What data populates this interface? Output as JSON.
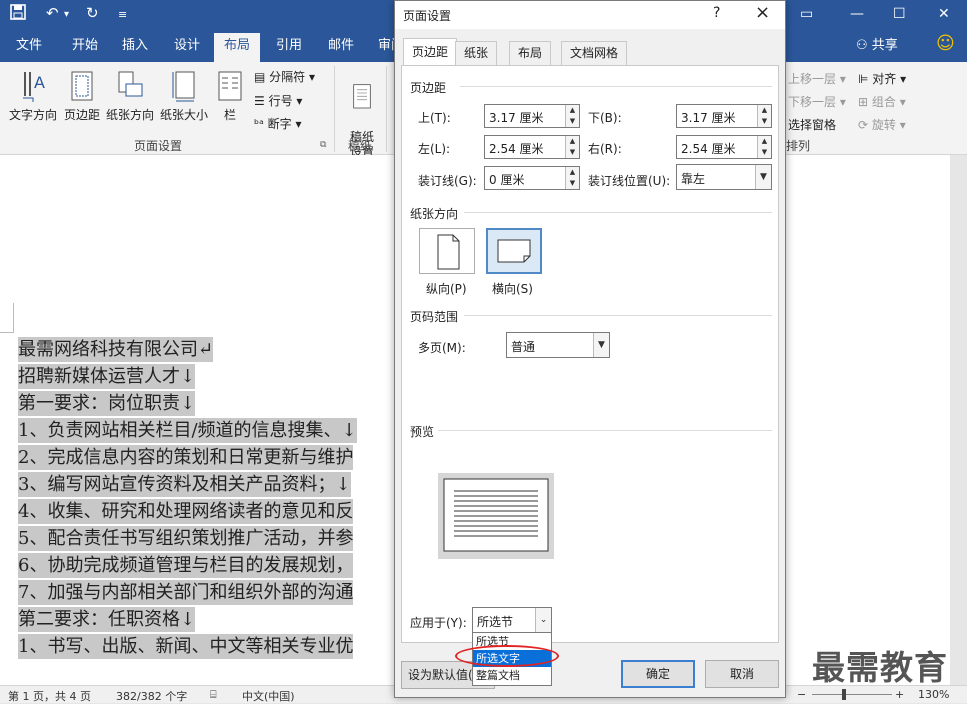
{
  "app": {
    "tabs": [
      "文件",
      "开始",
      "插入",
      "设计",
      "布局",
      "引用",
      "邮件",
      "审阅"
    ],
    "active_tab": "布局",
    "share_label": "共享",
    "quick_access": [
      "save-icon",
      "undo-icon",
      "redo-icon",
      "customize-icon"
    ]
  },
  "ribbon": {
    "page_setup": {
      "text_direction": "文字方向",
      "margins": "页边距",
      "orientation": "纸张方向",
      "size": "纸张大小",
      "columns": "栏",
      "breaks": "分隔符",
      "line_numbers": "行号",
      "hyphenation": "断字",
      "group_label": "页面设置"
    },
    "manuscript": {
      "button": "稿纸\n设置",
      "group_label": "稿纸"
    },
    "arrange": {
      "bring_forward": "上移一层",
      "send_backward": "下移一层",
      "selection_pane": "选择窗格",
      "align": "对齐",
      "group": "组合",
      "rotate": "旋转",
      "group_label": "排列"
    }
  },
  "dialog": {
    "title": "页面设置",
    "help": "?",
    "close": "×",
    "tabs": [
      "页边距",
      "纸张",
      "布局",
      "文档网格"
    ],
    "active_tab": "页边距",
    "margins_section": "页边距",
    "fields": {
      "top_label": "上(T):",
      "top_value": "3.17 厘米",
      "bottom_label": "下(B):",
      "bottom_value": "3.17 厘米",
      "left_label": "左(L):",
      "left_value": "2.54 厘米",
      "right_label": "右(R):",
      "right_value": "2.54 厘米",
      "gutter_label": "装订线(G):",
      "gutter_value": "0 厘米",
      "gutter_pos_label": "装订线位置(U):",
      "gutter_pos_value": "靠左"
    },
    "orientation_section": "纸张方向",
    "portrait": "纵向(P)",
    "landscape": "横向(S)",
    "selected_orientation": "横向(S)",
    "pages_section": "页码范围",
    "multiple_pages_label": "多页(M):",
    "multiple_pages_value": "普通",
    "preview_section": "预览",
    "apply_to_label": "应用于(Y):",
    "apply_to_value": "所选节",
    "apply_options": [
      "所选节",
      "所选文字",
      "整篇文档"
    ],
    "highlighted_option": "所选文字",
    "set_default": "设为默认值(D)",
    "ok": "确定",
    "cancel": "取消"
  },
  "document": {
    "lines": [
      "最需网络科技有限公司↵",
      "招聘新媒体运营人才↓",
      "第一要求：岗位职责↓",
      "1、负责网站相关栏目/频道的信息搜集、↓",
      "2、完成信息内容的策划和日常更新与维护",
      "3、编写网站宣传资料及相关产品资料；↓",
      "4、收集、研究和处理网络读者的意见和反",
      "5、配合责任书写组织策划推广活动，并参",
      "6、协助完成频道管理与栏目的发展规划，",
      "7、加强与内部相关部门和组织外部的沟通",
      "第二要求：任职资格↓",
      "1、书写、出版、新闻、中文等相关专业优"
    ]
  },
  "status": {
    "page": "第 1 页，共 4 页",
    "words": "382/382 个字",
    "language": "中文(中国)",
    "zoom": "130%"
  },
  "watermark": "最需教育",
  "colors": {
    "accent": "#2b579a",
    "highlight": "#0a6fd9",
    "annotation": "#e02424"
  }
}
